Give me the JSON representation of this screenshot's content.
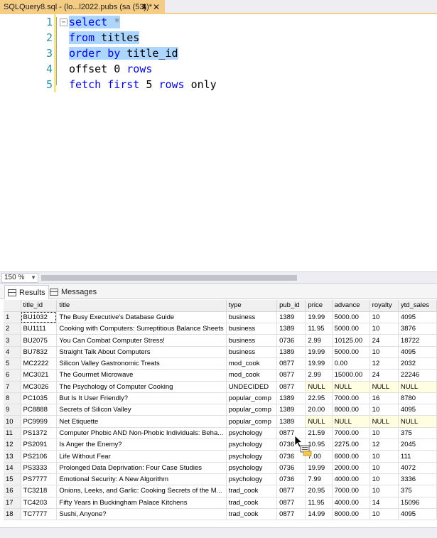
{
  "tab": {
    "title": "SQLQuery8.sql - (lo...l2022.pubs (sa (53))*",
    "close": "✕"
  },
  "editor": {
    "lines": [
      {
        "num": "1",
        "tokens": [
          {
            "t": "select",
            "c": "kw",
            "sel": true
          },
          {
            "t": " ",
            "c": "plain",
            "sel": true
          },
          {
            "t": "*",
            "c": "gray",
            "sel": true
          }
        ]
      },
      {
        "num": "2",
        "tokens": [
          {
            "t": "from",
            "c": "kw",
            "sel": true
          },
          {
            "t": " titles",
            "c": "plain",
            "sel": true
          }
        ]
      },
      {
        "num": "3",
        "tokens": [
          {
            "t": "order",
            "c": "kw",
            "sel": true
          },
          {
            "t": " ",
            "c": "plain",
            "sel": true
          },
          {
            "t": "by",
            "c": "kw",
            "sel": true
          },
          {
            "t": " title_id",
            "c": "plain",
            "sel": true
          }
        ]
      },
      {
        "num": "4",
        "tokens": [
          {
            "t": "offset 0 ",
            "c": "plain",
            "sel": false
          },
          {
            "t": "rows",
            "c": "kw",
            "sel": false
          }
        ]
      },
      {
        "num": "5",
        "tokens": [
          {
            "t": "fetch",
            "c": "kw",
            "sel": false
          },
          {
            "t": " ",
            "c": "plain",
            "sel": false
          },
          {
            "t": "first",
            "c": "kw",
            "sel": false
          },
          {
            "t": " 5 ",
            "c": "plain",
            "sel": false
          },
          {
            "t": "rows",
            "c": "kw",
            "sel": false
          },
          {
            "t": " ",
            "c": "plain",
            "sel": false
          },
          {
            "t": "only",
            "c": "plain",
            "sel": false
          }
        ]
      }
    ]
  },
  "zoom": {
    "value": "150 %"
  },
  "results_tabs": {
    "results": "Results",
    "messages": "Messages"
  },
  "grid": {
    "columns": [
      "title_id",
      "title",
      "type",
      "pub_id",
      "price",
      "advance",
      "royalty",
      "ytd_sales"
    ],
    "rows": [
      [
        "1",
        "BU1032",
        "The Busy Executive's Database Guide",
        "business",
        "1389",
        "19.99",
        "5000.00",
        "10",
        "4095"
      ],
      [
        "2",
        "BU1111",
        "Cooking with Computers: Surreptitious Balance Sheets",
        "business",
        "1389",
        "11.95",
        "5000.00",
        "10",
        "3876"
      ],
      [
        "3",
        "BU2075",
        "You Can Combat Computer Stress!",
        "business",
        "0736",
        "2.99",
        "10125.00",
        "24",
        "18722"
      ],
      [
        "4",
        "BU7832",
        "Straight Talk About Computers",
        "business",
        "1389",
        "19.99",
        "5000.00",
        "10",
        "4095"
      ],
      [
        "5",
        "MC2222",
        "Silicon Valley Gastronomic Treats",
        "mod_cook",
        "0877",
        "19.99",
        "0.00",
        "12",
        "2032"
      ],
      [
        "6",
        "MC3021",
        "The Gourmet Microwave",
        "mod_cook",
        "0877",
        "2.99",
        "15000.00",
        "24",
        "22246"
      ],
      [
        "7",
        "MC3026",
        "The Psychology of Computer Cooking",
        "UNDECIDED",
        "0877",
        "NULL",
        "NULL",
        "NULL",
        "NULL"
      ],
      [
        "8",
        "PC1035",
        "But Is It User Friendly?",
        "popular_comp",
        "1389",
        "22.95",
        "7000.00",
        "16",
        "8780"
      ],
      [
        "9",
        "PC8888",
        "Secrets of Silicon Valley",
        "popular_comp",
        "1389",
        "20.00",
        "8000.00",
        "10",
        "4095"
      ],
      [
        "10",
        "PC9999",
        "Net Etiquette",
        "popular_comp",
        "1389",
        "NULL",
        "NULL",
        "NULL",
        "NULL"
      ],
      [
        "11",
        "PS1372",
        "Computer Phobic AND Non-Phobic Individuals: Beha...",
        "psychology",
        "0877",
        "21.59",
        "7000.00",
        "10",
        "375"
      ],
      [
        "12",
        "PS2091",
        "Is Anger the Enemy?",
        "psychology",
        "0736",
        "10.95",
        "2275.00",
        "12",
        "2045"
      ],
      [
        "13",
        "PS2106",
        "Life Without Fear",
        "psychology",
        "0736",
        "7.00",
        "6000.00",
        "10",
        "111"
      ],
      [
        "14",
        "PS3333",
        "Prolonged Data Deprivation: Four Case Studies",
        "psychology",
        "0736",
        "19.99",
        "2000.00",
        "10",
        "4072"
      ],
      [
        "15",
        "PS7777",
        "Emotional Security: A New Algorithm",
        "psychology",
        "0736",
        "7.99",
        "4000.00",
        "10",
        "3336"
      ],
      [
        "16",
        "TC3218",
        "Onions, Leeks, and Garlic: Cooking Secrets of the M...",
        "trad_cook",
        "0877",
        "20.95",
        "7000.00",
        "10",
        "375"
      ],
      [
        "17",
        "TC4203",
        "Fifty Years in Buckingham Palace Kitchens",
        "trad_cook",
        "0877",
        "11.95",
        "4000.00",
        "14",
        "15096"
      ],
      [
        "18",
        "TC7777",
        "Sushi, Anyone?",
        "trad_cook",
        "0877",
        "14.99",
        "8000.00",
        "10",
        "4095"
      ]
    ]
  },
  "icons": {
    "pin": "pin-icon",
    "close": "close-icon",
    "results": "grid-icon",
    "messages": "messages-icon",
    "cursor": "drag-copy-cursor-icon"
  },
  "colors": {
    "tab_active": "#f5cc84",
    "selection": "#add6ff",
    "keyword": "#0000ff",
    "line_number": "#2b91af",
    "null_cell": "#fffee1"
  }
}
